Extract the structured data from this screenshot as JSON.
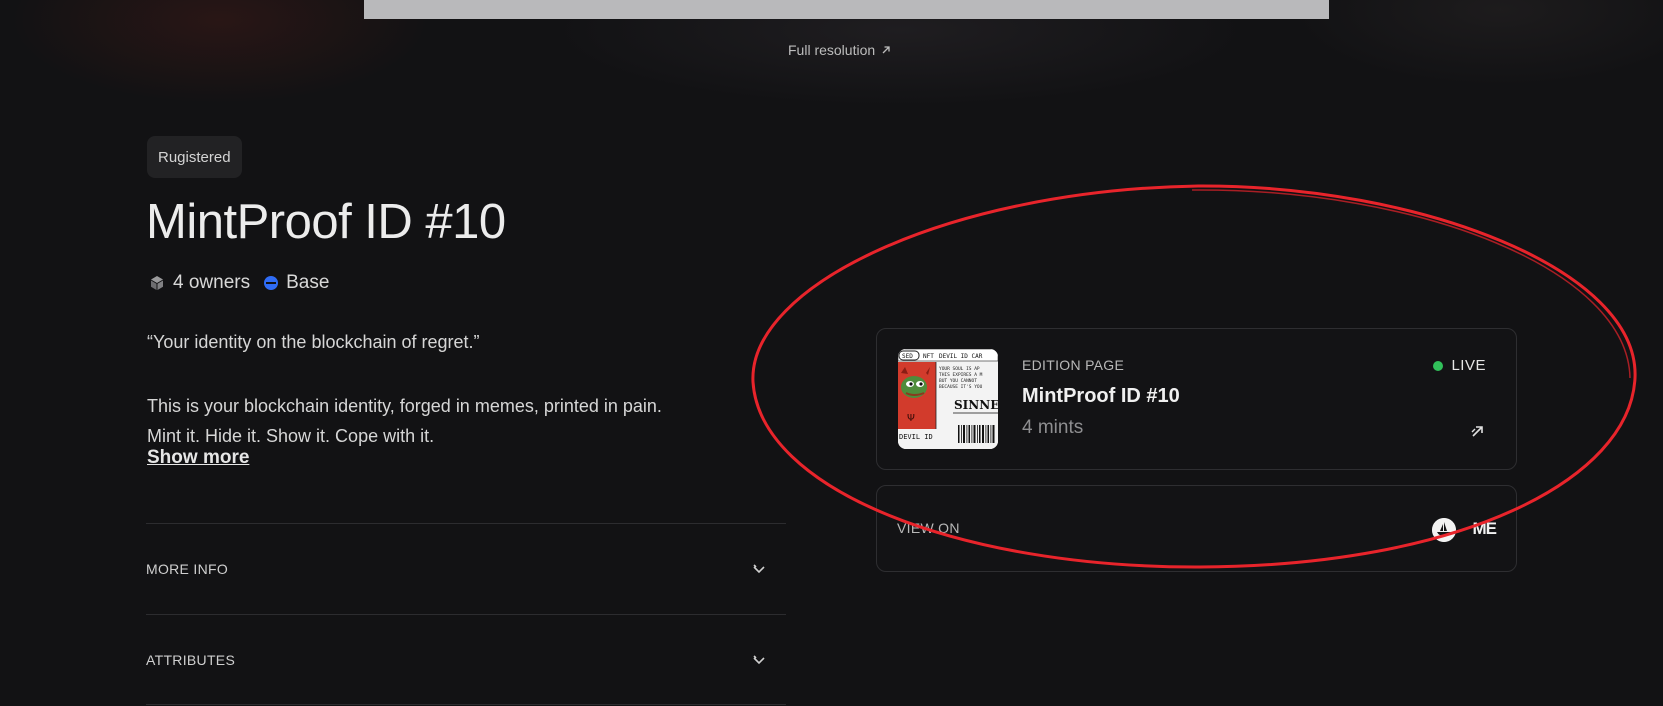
{
  "media": {
    "full_resolution_label": "Full resolution",
    "full_resolution_icon": "arrow-up-right-icon"
  },
  "collection": {
    "tag": "Rugistered",
    "title": "MintProof ID #10",
    "owners": "4 owners",
    "owners_icon": "cube-icon",
    "chain": "Base",
    "chain_icon": "base-chain-icon",
    "chain_color": "#2f6cf6"
  },
  "description": {
    "quote": "“Your identity on the blockchain of regret.”",
    "line1": "This is your blockchain identity, forged in memes, printed in pain.",
    "line2": "Mint it. Hide it. Show it. Cope with it.",
    "show_more": "Show more"
  },
  "accordions": [
    {
      "label": "MORE INFO",
      "icon": "chevron-down-icon"
    },
    {
      "label": "ATTRIBUTES",
      "icon": "chevron-down-icon"
    }
  ],
  "edition_card": {
    "label": "EDITION PAGE",
    "title": "MintProof ID #10",
    "mints": "4 mints",
    "status": "LIVE",
    "status_color": "#31c05a",
    "thumbnail": {
      "header_left": "NFT",
      "header_right": "DEVIL ID CAR",
      "badge": "SED",
      "lines": [
        "YOUR SOUL IS AP",
        "THIS EXPIRES A M",
        "BUT YOU CANNOT",
        "BECAUSE IT'S YOU"
      ],
      "stamp": "SINNE",
      "footer": "DEVIL ID"
    }
  },
  "view_on": {
    "label": "VIEW ON",
    "marketplaces": [
      {
        "name": "opensea-icon"
      },
      {
        "name": "magic-eden-icon",
        "text": "ME"
      }
    ]
  },
  "annotation": {
    "color": "#e8242b"
  }
}
